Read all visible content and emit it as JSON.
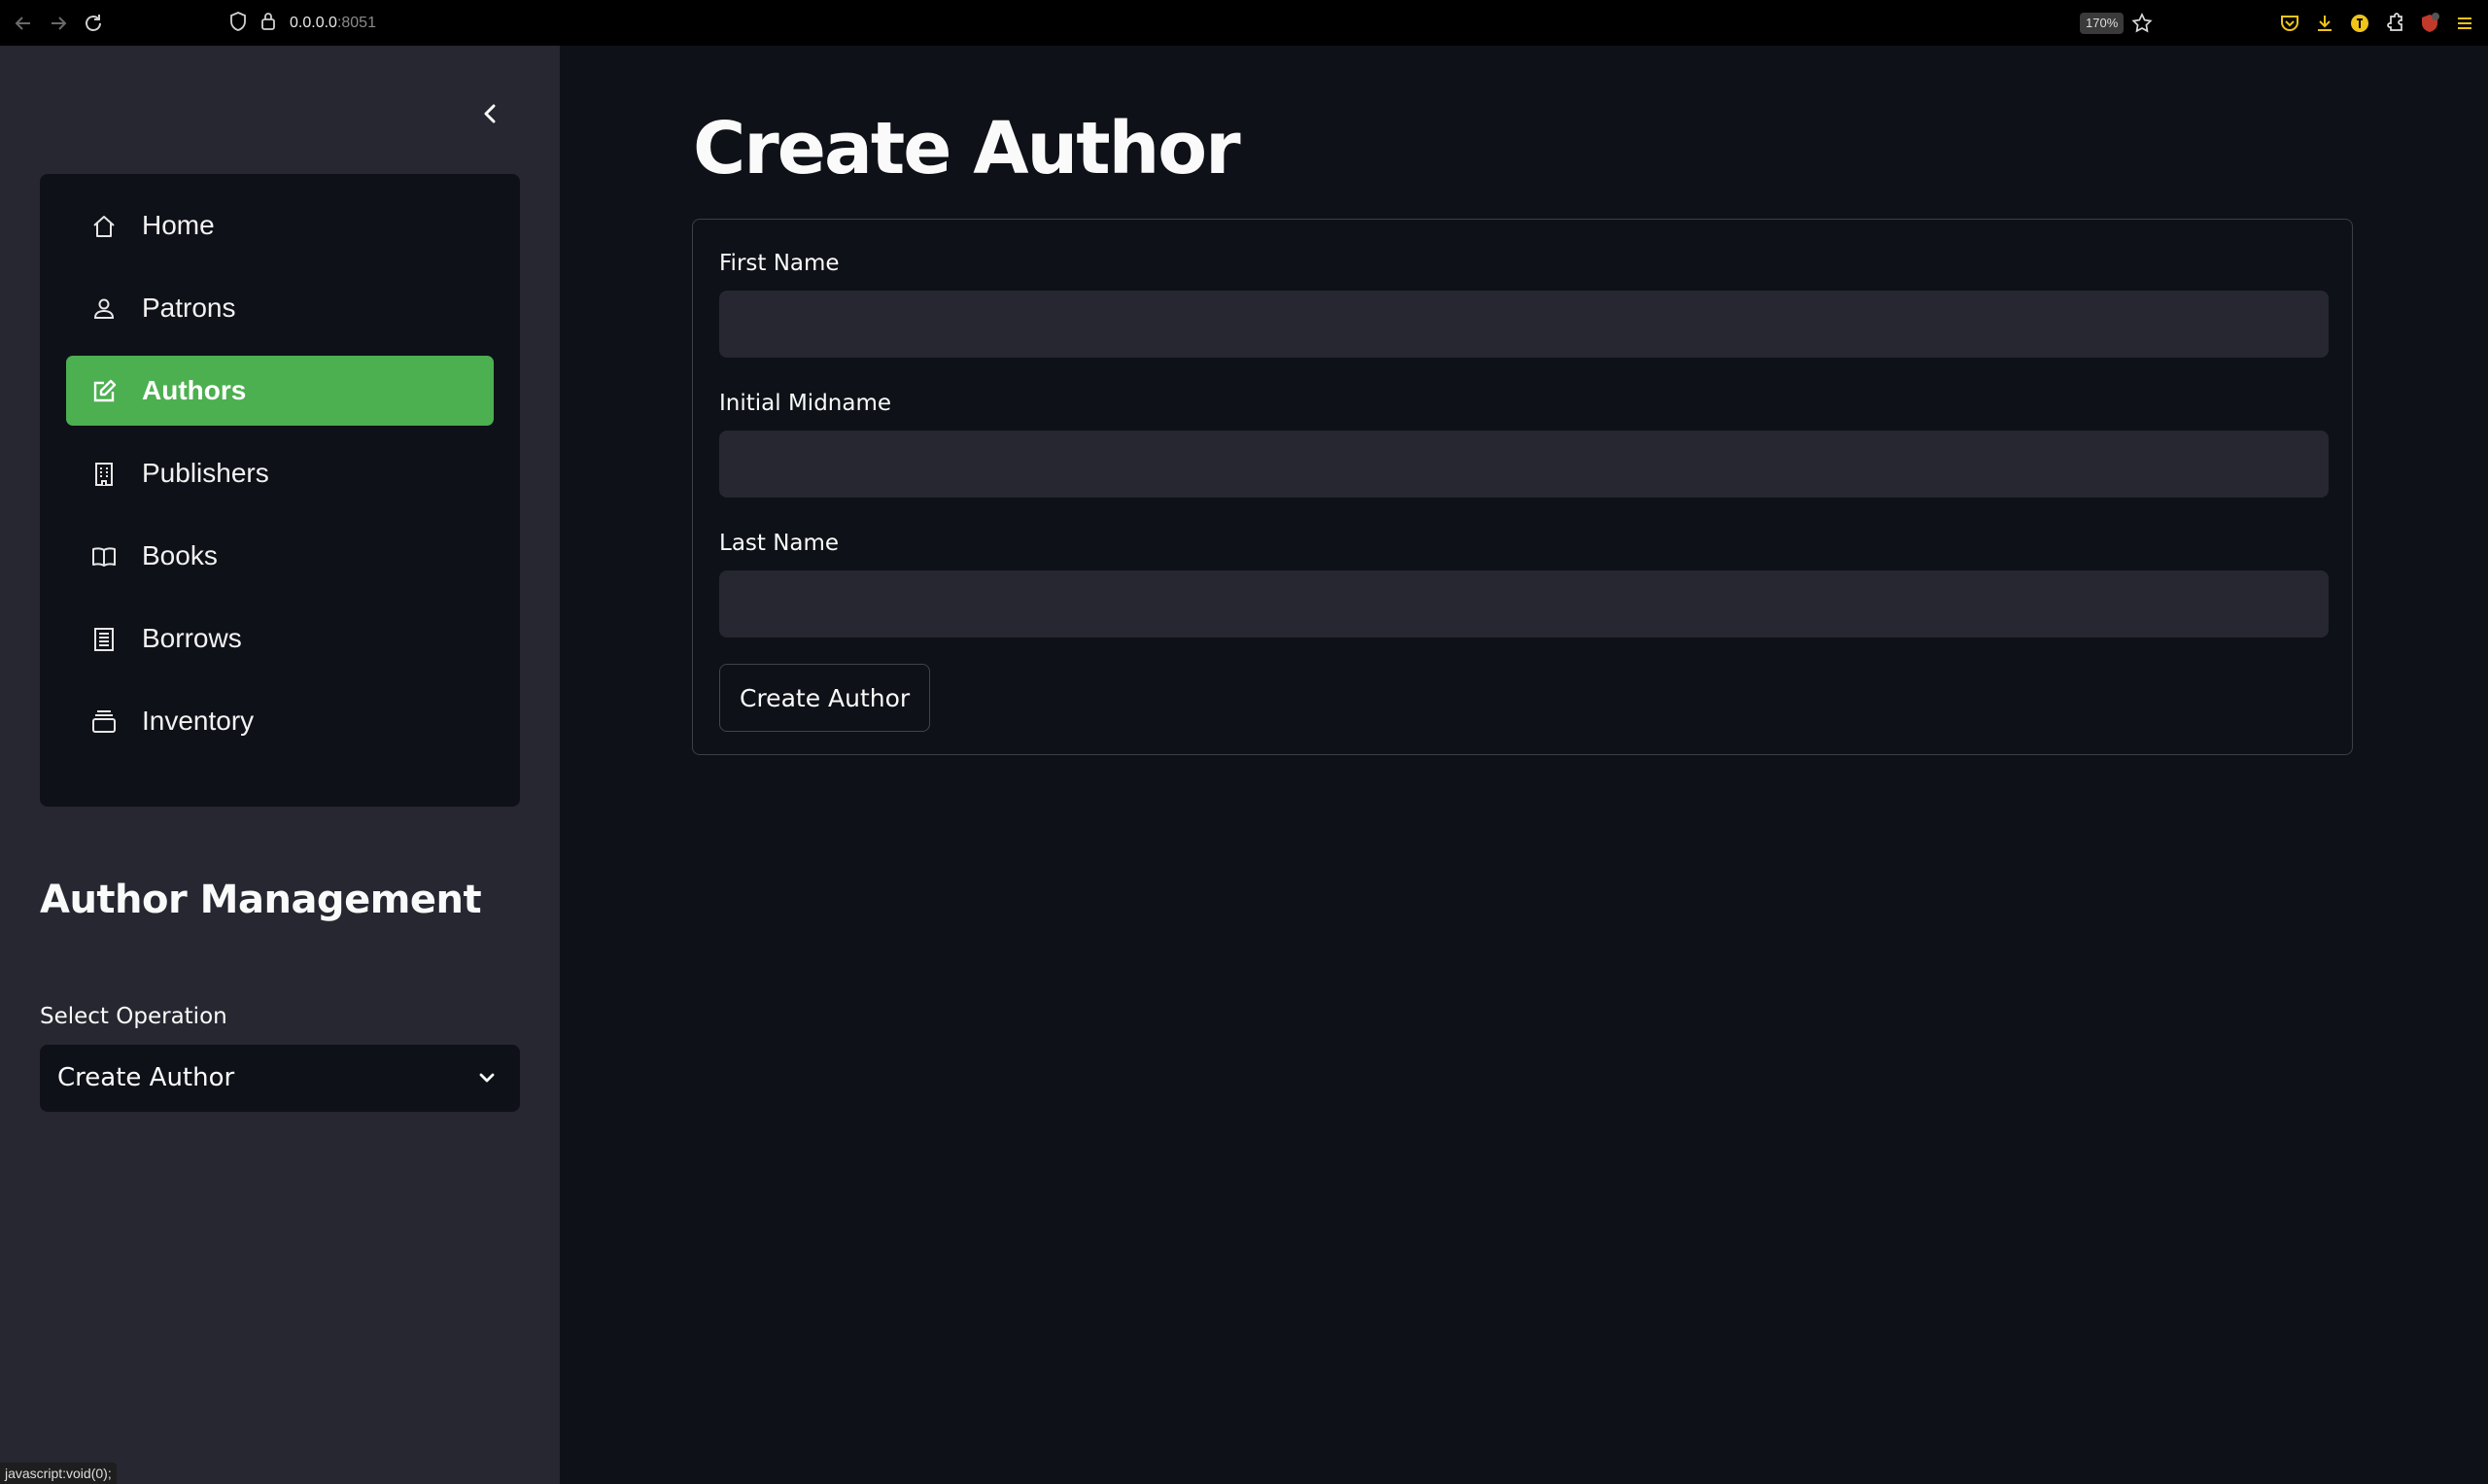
{
  "browser": {
    "url_host": "0.0.0.0",
    "url_port": ":8051",
    "zoom": "170%",
    "status_link": "javascript:void(0);"
  },
  "sidebar": {
    "nav_items": [
      {
        "label": "Home",
        "icon": "home-icon",
        "active": false
      },
      {
        "label": "Patrons",
        "icon": "person-icon",
        "active": false
      },
      {
        "label": "Authors",
        "icon": "edit-icon",
        "active": true
      },
      {
        "label": "Publishers",
        "icon": "building-icon",
        "active": false
      },
      {
        "label": "Books",
        "icon": "book-icon",
        "active": false
      },
      {
        "label": "Borrows",
        "icon": "receipt-icon",
        "active": false
      },
      {
        "label": "Inventory",
        "icon": "stack-icon",
        "active": false
      }
    ],
    "section_title": "Author Management",
    "select_label": "Select Operation",
    "select_value": "Create Author"
  },
  "main": {
    "title": "Create Author",
    "fields": [
      {
        "label": "First Name",
        "value": "",
        "placeholder": ""
      },
      {
        "label": "Initial Midname",
        "value": "",
        "placeholder": ""
      },
      {
        "label": "Last Name",
        "value": "",
        "placeholder": ""
      }
    ],
    "submit_label": "Create Author"
  },
  "colors": {
    "accent": "#4caf50",
    "background": "#0e1117",
    "sidebar": "#262730",
    "input": "#262730"
  }
}
